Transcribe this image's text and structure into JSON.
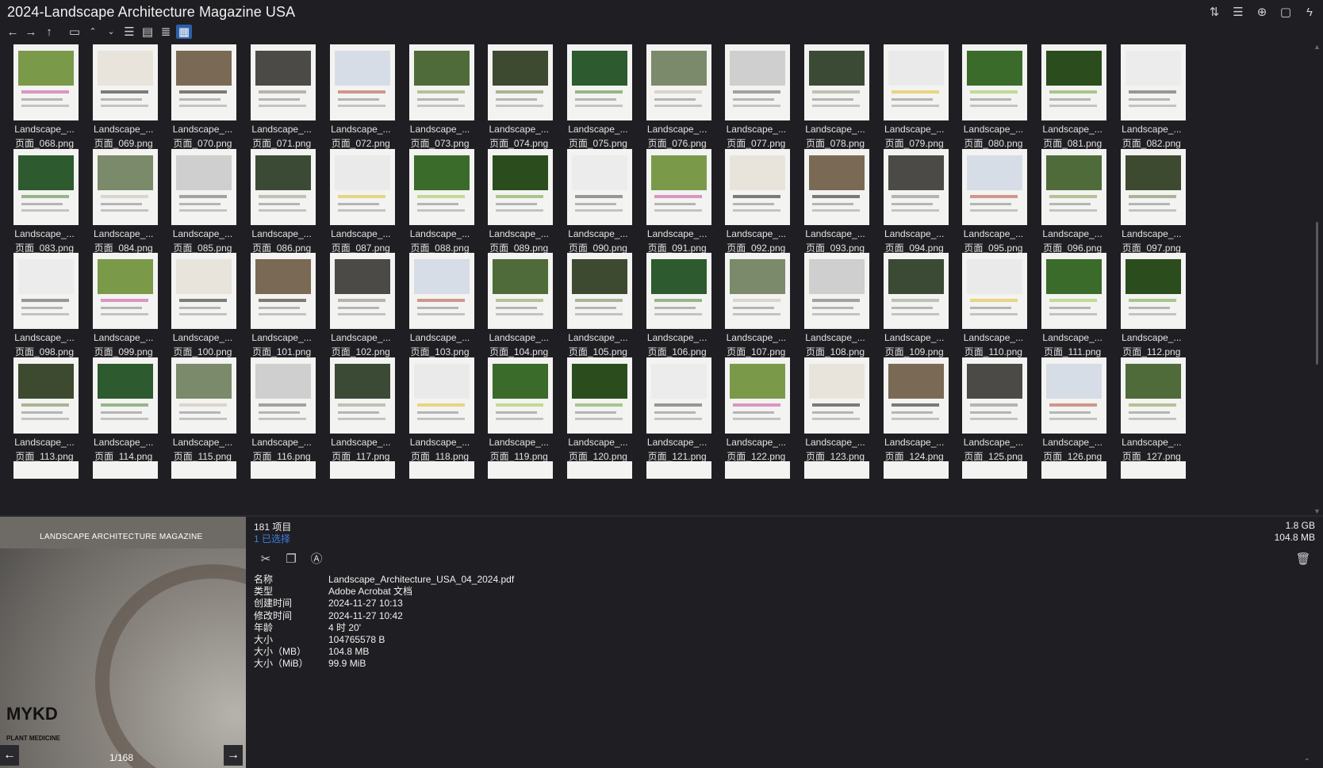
{
  "window": {
    "title": "2024-Landscape Architecture Magazine USA",
    "top_icons": [
      "sort-icon",
      "details-list-icon",
      "add-icon",
      "clipboard-icon",
      "lightning-icon"
    ]
  },
  "toolbar": {
    "back": "←",
    "forward": "→",
    "up": "↑",
    "view_modes": [
      "list-view-icon",
      "details-view-icon",
      "tree-view-icon",
      "thumbnail-view-icon"
    ]
  },
  "thumbnails": {
    "name_prefix": "Landscape_...",
    "rows": [
      [
        "页面_068.png",
        "页面_069.png",
        "页面_070.png",
        "页面_071.png",
        "页面_072.png",
        "页面_073.png",
        "页面_074.png",
        "页面_075.png",
        "页面_076.png",
        "页面_077.png",
        "页面_078.png",
        "页面_079.png",
        "页面_080.png",
        "页面_081.png",
        "页面_082.png"
      ],
      [
        "页面_083.png",
        "页面_084.png",
        "页面_085.png",
        "页面_086.png",
        "页面_087.png",
        "页面_088.png",
        "页面_089.png",
        "页面_090.png",
        "页面_091.png",
        "页面_092.png",
        "页面_093.png",
        "页面_094.png",
        "页面_095.png",
        "页面_096.png",
        "页面_097.png"
      ],
      [
        "页面_098.png",
        "页面_099.png",
        "页面_100.png",
        "页面_101.png",
        "页面_102.png",
        "页面_103.png",
        "页面_104.png",
        "页面_105.png",
        "页面_106.png",
        "页面_107.png",
        "页面_108.png",
        "页面_109.png",
        "页面_110.png",
        "页面_111.png",
        "页面_112.png"
      ],
      [
        "页面_113.png",
        "页面_114.png",
        "页面_115.png",
        "页面_116.png",
        "页面_117.png",
        "页面_118.png",
        "页面_119.png",
        "页面_120.png",
        "页面_121.png",
        "页面_122.png",
        "页面_123.png",
        "页面_124.png",
        "页面_125.png",
        "页面_126.png",
        "页面_127.png"
      ]
    ]
  },
  "preview": {
    "magazine_title": "LANDSCAPE ARCHITECTURE MAGAZINE",
    "cover_headline": "MYKD",
    "cover_subline": "PLANT MEDICINE",
    "page_counter": "1/168",
    "prev_label": "←",
    "next_label": "→"
  },
  "info": {
    "item_count": "181 项目",
    "selected_count": "1 已选择",
    "total_size": "1.8 GB",
    "selected_size": "104.8 MB",
    "properties": [
      {
        "key": "名称",
        "value": "Landscape_Architecture_USA_04_2024.pdf"
      },
      {
        "key": "类型",
        "value": "Adobe Acrobat 文档"
      },
      {
        "key": "创建时间",
        "value": "2024-11-27  10:13"
      },
      {
        "key": "修改时间",
        "value": "2024-11-27  10:42"
      },
      {
        "key": "年龄",
        "value": "4 时 20'"
      },
      {
        "key": "大小",
        "value": "104765578 B"
      },
      {
        "key": "大小（MB）",
        "value": "104.8 MB"
      },
      {
        "key": "大小（MiB）",
        "value": "99.9 MiB"
      }
    ]
  }
}
